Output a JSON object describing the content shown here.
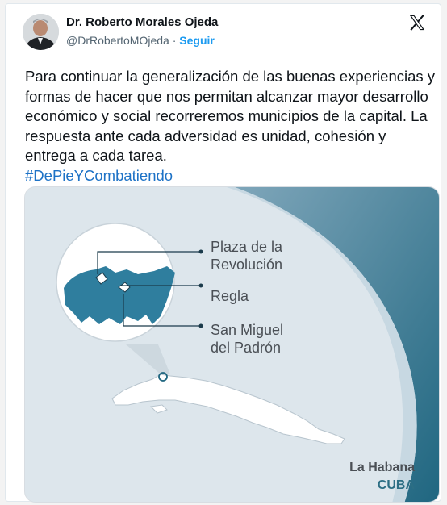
{
  "author": {
    "name": "Dr. Roberto Morales Ojeda",
    "handle": "@DrRobertoMOjeda",
    "separator": "·",
    "follow_label": "Seguir"
  },
  "tweet": {
    "text": "Para continuar la generalización de las buenas experiencias y formas de hacer que nos permitan alcanzar mayor desarrollo económico y social recorreremos municipios de la capital. La respuesta ante cada adversidad es unidad, cohesión y entrega a cada tarea.",
    "hashtag": "#DePieYCombatiendo"
  },
  "media": {
    "locations": [
      "Plaza de la\nRevolución",
      "Regla",
      "San Miguel\ndel Padrón"
    ],
    "city": "La Habana",
    "country": "CUBA"
  },
  "icons": {
    "platform": "x-logo-icon",
    "avatar": "avatar"
  },
  "colors": {
    "accent": "#1d9bf0",
    "hashtag": "#1d72c6",
    "map_fill": "#2f7e9e",
    "country_label": "#2c6e84"
  }
}
